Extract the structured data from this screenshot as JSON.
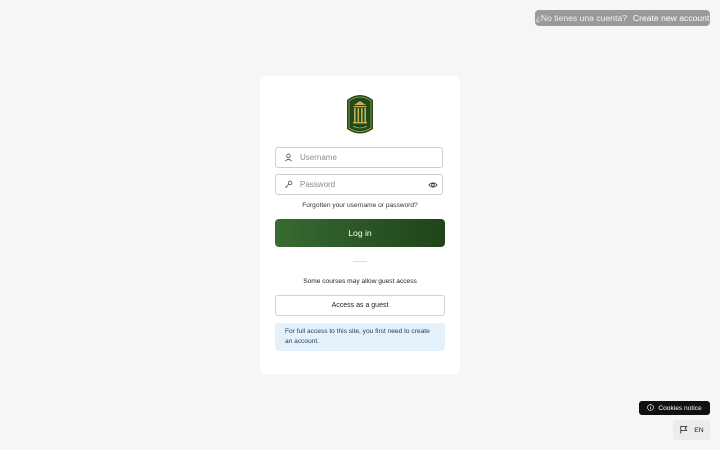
{
  "header": {
    "signup_question": "¿No tienes una cuenta?",
    "signup_link": "Create new account"
  },
  "login": {
    "logo_icon": "university-crest-icon",
    "username_placeholder": "Username",
    "username_icon": "user-icon",
    "password_placeholder": "Password",
    "password_icon": "key-icon",
    "show_password_icon": "eye-icon",
    "forgot_link": "Forgotten your username or password?",
    "login_button": "Log in",
    "guest_note": "Some courses may allow guest access",
    "guest_button": "Access as a guest",
    "info_text": "For full access to this site, you first need to create an account."
  },
  "footer": {
    "cookies_label": "Cookies notice",
    "cookies_icon": "info-circle-icon",
    "language_label": "EN",
    "language_icon": "flag-icon"
  },
  "colors": {
    "primary_green": "#2b5727",
    "info_background": "#e4f1fb",
    "page_background": "#f6f6f6"
  }
}
